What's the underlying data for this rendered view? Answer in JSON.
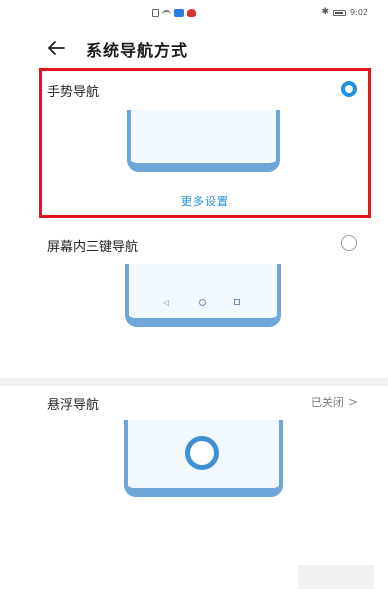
{
  "status_bar": {
    "time": "9:02",
    "left_icons": [
      "document-icon",
      "wifi-icon",
      "blue-app-icon",
      "red-app-icon"
    ],
    "right_icons": [
      "bluetooth-icon",
      "battery-icon"
    ]
  },
  "header": {
    "back_icon": "back-arrow-icon",
    "title": "系统导航方式"
  },
  "options": {
    "gesture": {
      "label": "手势导航",
      "selected": true,
      "more_settings": "更多设置"
    },
    "three_key": {
      "label": "屏幕内三键导航",
      "selected": false,
      "keys": [
        "◁",
        "○",
        "□"
      ]
    },
    "floating": {
      "label": "悬浮导航",
      "status": "已关闭",
      "chevron": ">"
    }
  },
  "colors": {
    "accent": "#1e90e6",
    "highlight_border": "#e3141c",
    "phone_frame": "#6fa6d9",
    "phone_screen": "#f2f9fe"
  }
}
